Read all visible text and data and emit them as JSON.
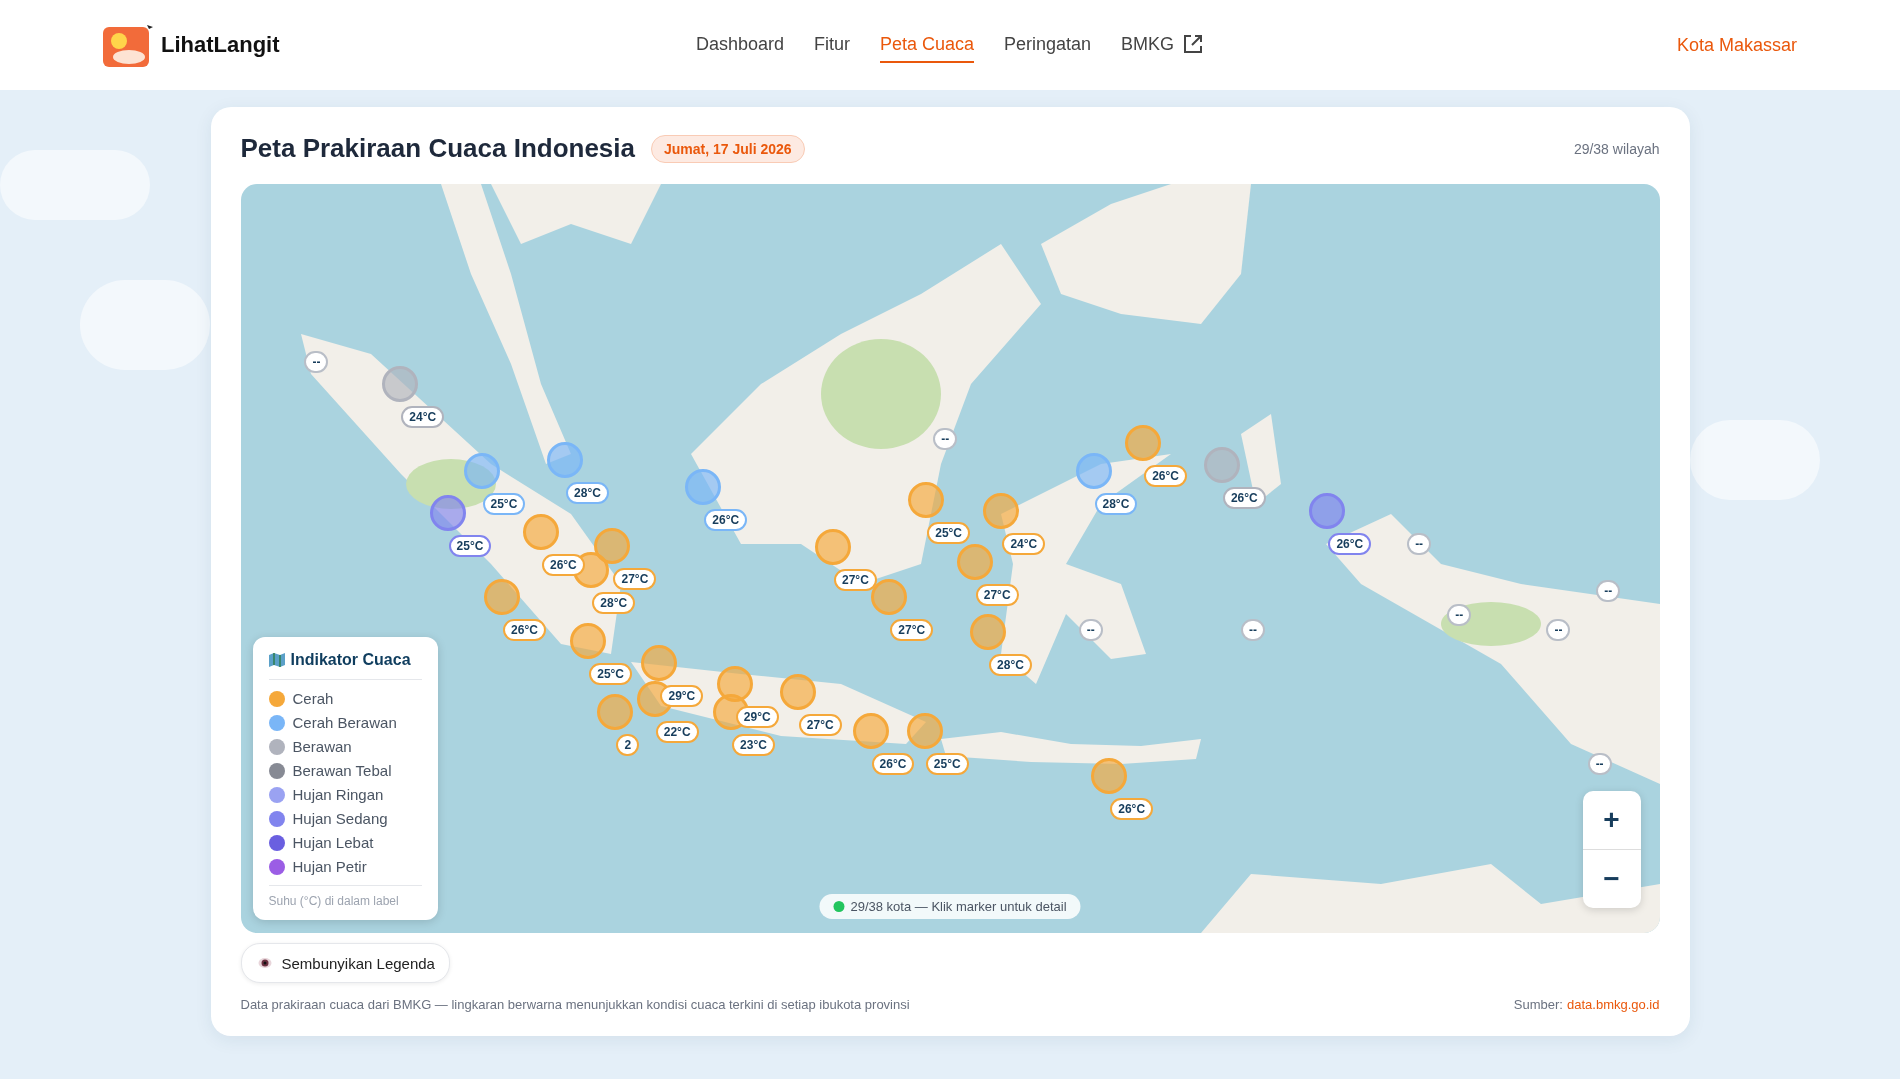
{
  "brand": {
    "name": "LihatLangit"
  },
  "nav": [
    {
      "label": "Dashboard",
      "selected": false,
      "external": false
    },
    {
      "label": "Fitur",
      "selected": false,
      "external": false
    },
    {
      "label": "Peta Cuaca",
      "selected": true,
      "external": false
    },
    {
      "label": "Peringatan",
      "selected": false,
      "external": false
    },
    {
      "label": "BMKG",
      "selected": false,
      "external": true
    }
  ],
  "location": "Kota Makassar",
  "card": {
    "title": "Peta Prakiraan Cuaca Indonesia",
    "date_badge": "Jumat, 17 Juli 2026",
    "region_count": "29/38 wilayah"
  },
  "map": {
    "markers": [
      {
        "kind": "no-data",
        "label": "--"
      },
      {
        "kind": "reading",
        "color": "#b0b3bd",
        "label": "24°C"
      },
      {
        "kind": "no-data",
        "label": "--"
      },
      {
        "kind": "reading",
        "color": "#f5a83a",
        "label": "26°C"
      },
      {
        "kind": "reading",
        "color": "#7ab6f7",
        "label": "28°C"
      },
      {
        "kind": "reading",
        "color": "#b0b3bd",
        "label": "26°C"
      },
      {
        "kind": "reading",
        "color": "#7ab6f7",
        "label": "25°C"
      },
      {
        "kind": "reading",
        "color": "#7ab6f7",
        "label": "28°C"
      },
      {
        "kind": "reading",
        "color": "#7ab6f7",
        "label": "26°C"
      },
      {
        "kind": "reading",
        "color": "#f5a83a",
        "label": "25°C"
      },
      {
        "kind": "reading",
        "color": "#8184ee",
        "label": "25°C"
      },
      {
        "kind": "reading",
        "color": "#f5a83a",
        "label": "24°C"
      },
      {
        "kind": "reading",
        "color": "#8184ee",
        "label": "26°C"
      },
      {
        "kind": "no-data",
        "label": "--"
      },
      {
        "kind": "reading",
        "color": "#f5a83a",
        "label": "26°C"
      },
      {
        "kind": "reading",
        "color": "#f5a83a",
        "label": "27°C"
      },
      {
        "kind": "reading",
        "color": "#f5a83a",
        "label": "27°C"
      },
      {
        "kind": "reading",
        "color": "#f5a83a",
        "label": "27°C"
      },
      {
        "kind": "no-data",
        "label": "--"
      },
      {
        "kind": "reading",
        "color": "#f5a83a",
        "label": "28°C"
      },
      {
        "kind": "no-data",
        "label": "--"
      },
      {
        "kind": "reading",
        "color": "#f5a83a",
        "label": "26°C"
      },
      {
        "kind": "reading",
        "color": "#f5a83a",
        "label": "27°C"
      },
      {
        "kind": "no-data",
        "label": "--"
      },
      {
        "kind": "no-data",
        "label": "--"
      },
      {
        "kind": "no-data",
        "label": "--"
      },
      {
        "kind": "reading",
        "color": "#f5a83a",
        "label": "28°C"
      },
      {
        "kind": "reading",
        "color": "#f5a83a",
        "label": "25°C"
      },
      {
        "kind": "reading",
        "color": "#f5a83a",
        "label": "29°C"
      },
      {
        "kind": "reading",
        "color": "#f5a83a",
        "label": "29°C"
      },
      {
        "kind": "reading",
        "color": "#f5a83a",
        "label": "27°C"
      },
      {
        "kind": "reading",
        "color": "#f5a83a",
        "label": "22°C"
      },
      {
        "kind": "reading",
        "color": "#f5a83a",
        "label": "2"
      },
      {
        "kind": "reading",
        "color": "#f5a83a",
        "label": "23°C"
      },
      {
        "kind": "reading",
        "color": "#f5a83a",
        "label": "26°C"
      },
      {
        "kind": "reading",
        "color": "#f5a83a",
        "label": "25°C"
      },
      {
        "kind": "no-data",
        "label": "--"
      },
      {
        "kind": "reading",
        "color": "#f5a83a",
        "label": "26°C"
      }
    ],
    "status": "29/38 kota — Klik marker untuk detail",
    "zoom_in": "+",
    "zoom_out": "−"
  },
  "legend": {
    "title": "Indikator Cuaca",
    "items": [
      {
        "label": "Cerah",
        "color": "#f5a83a"
      },
      {
        "label": "Cerah Berawan",
        "color": "#7ab6f7"
      },
      {
        "label": "Berawan",
        "color": "#b0b3bd"
      },
      {
        "label": "Berawan Tebal",
        "color": "#878a94"
      },
      {
        "label": "Hujan Ringan",
        "color": "#9aa2f2"
      },
      {
        "label": "Hujan Sedang",
        "color": "#8184ee"
      },
      {
        "label": "Hujan Lebat",
        "color": "#6a5fe0"
      },
      {
        "label": "Hujan Petir",
        "color": "#9b5de5"
      }
    ],
    "note": "Suhu (°C) di dalam label"
  },
  "toggle_button": "Sembunyikan Legenda",
  "footer": {
    "description": "Data prakiraan cuaca dari BMKG — lingkaran berwarna menunjukkan kondisi cuaca terkini di setiap ibukota provinsi",
    "source_label": "Sumber:",
    "source_link": "data.bmkg.go.id"
  }
}
